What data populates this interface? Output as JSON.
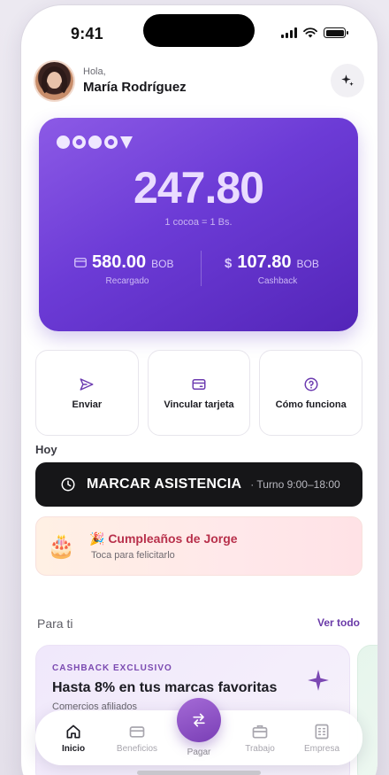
{
  "status_bar": {
    "time": "9:41"
  },
  "header": {
    "greeting": "Hola,",
    "name": "María Rodríguez"
  },
  "balance_card": {
    "amount": "247.80",
    "rate": "1 cocoa = 1 Bs.",
    "recharged": {
      "value": "580.00",
      "currency": "BOB",
      "label": "Recargado"
    },
    "cashback": {
      "value": "107.80",
      "currency": "BOB",
      "label": "Cashback"
    }
  },
  "actions": [
    {
      "label": "Enviar",
      "icon": "send-icon"
    },
    {
      "label": "Vincular tarjeta",
      "icon": "card-icon"
    },
    {
      "label": "Cómo funciona",
      "icon": "help-icon"
    }
  ],
  "today": {
    "title": "Hoy",
    "attendance": {
      "label": "MARCAR ASISTENCIA",
      "shift": "· Turno 9:00–18:00"
    },
    "birthday": {
      "title": "🎉 Cumpleaños de Jorge",
      "subtitle": "Toca para felicitarlo",
      "icon": "🎂"
    }
  },
  "for_you": {
    "title": "Para ti",
    "see_all": "Ver todo",
    "promo": {
      "eyebrow": "CASHBACK EXCLUSIVO",
      "title": "Hasta 8% en tus marcas favoritas",
      "subtitle": "Comercios afiliados"
    }
  },
  "tabbar": {
    "home": "Inicio",
    "benefits": "Beneficios",
    "pay": "Pagar",
    "work": "Trabajo",
    "company": "Empresa"
  },
  "colors": {
    "accent": "#6c3bd6",
    "attendance_bg": "#161618",
    "birthday_text": "#b8304b"
  }
}
